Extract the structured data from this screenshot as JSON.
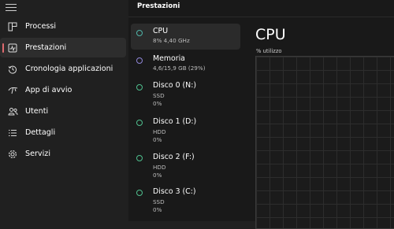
{
  "sidebar": {
    "items": [
      {
        "label": "Processi",
        "icon": "processes-icon"
      },
      {
        "label": "Prestazioni",
        "icon": "performance-icon"
      },
      {
        "label": "Cronologia applicazioni",
        "icon": "history-icon"
      },
      {
        "label": "App di avvio",
        "icon": "startup-icon"
      },
      {
        "label": "Utenti",
        "icon": "users-icon"
      },
      {
        "label": "Dettagli",
        "icon": "details-icon"
      },
      {
        "label": "Servizi",
        "icon": "services-icon"
      }
    ],
    "active_index": 1
  },
  "header": {
    "title": "Prestazioni"
  },
  "devices": [
    {
      "name": "CPU",
      "line1": "8% 4,40 GHz",
      "line2": "",
      "color": "#4fb5a8"
    },
    {
      "name": "Memoria",
      "line1": "4,6/15,9 GB (29%)",
      "line2": "",
      "color": "#8f86d8"
    },
    {
      "name": "Disco 0 (N:)",
      "line1": "SSD",
      "line2": "0%",
      "color": "#4fbf8e"
    },
    {
      "name": "Disco 1 (D:)",
      "line1": "HDD",
      "line2": "0%",
      "color": "#4fbf8e"
    },
    {
      "name": "Disco 2 (F:)",
      "line1": "HDD",
      "line2": "0%",
      "color": "#4fbf8e"
    },
    {
      "name": "Disco 3 (C:)",
      "line1": "SSD",
      "line2": "0%",
      "color": "#4fbf8e"
    }
  ],
  "detail": {
    "title": "CPU",
    "subtitle": "% utilizzo"
  },
  "colors": {
    "accent": "#e06a6f",
    "cpu_line": "#4fb5a8"
  }
}
